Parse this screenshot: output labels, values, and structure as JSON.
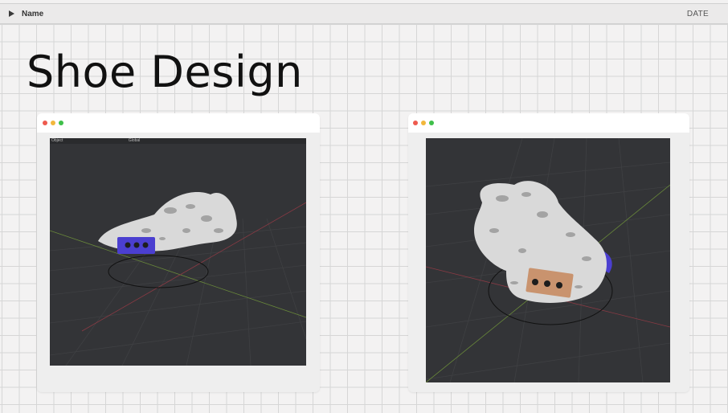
{
  "header": {
    "name_label": "Name",
    "date_label": "DATE"
  },
  "page": {
    "title": "Shoe Design"
  },
  "windows": [
    {
      "label": "left-window",
      "viewport_toolbar": "Object",
      "mode_label": "Global"
    },
    {
      "label": "right-window"
    }
  ],
  "colors": {
    "dot_red": "#ee5a4e",
    "dot_yellow": "#f2b73c",
    "dot_green": "#3fbf4a",
    "viewport_bg": "#333437",
    "accent_blue": "#4b3fd0",
    "accent_tan": "#c9936e"
  }
}
